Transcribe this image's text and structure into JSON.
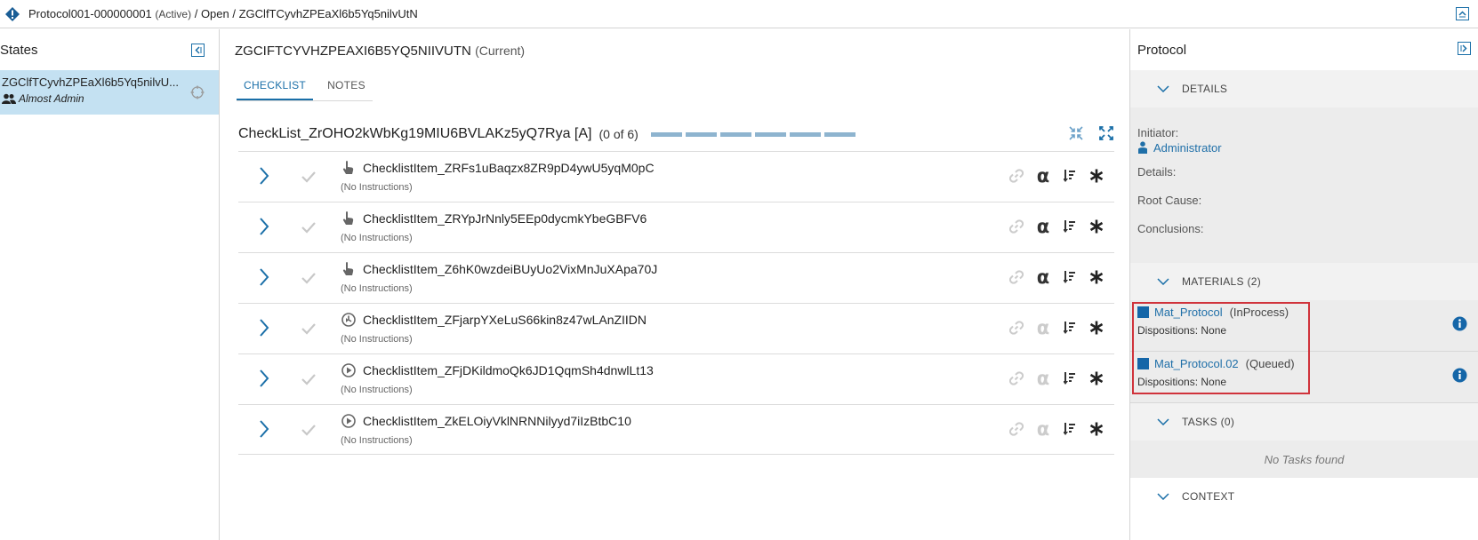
{
  "topbar": {
    "protocol_id": "Protocol001-000000001",
    "protocol_status": "(Active)",
    "sep1": " / ",
    "state": "Open",
    "sep2": " / ",
    "item": "ZGClfTCyvhZPEaXl6b5Yq5nilvUtN"
  },
  "left": {
    "title": "States",
    "items": [
      {
        "name": "ZGClfTCyvhZPEaXl6b5Yq5nilvU...",
        "user": "Almost Admin"
      }
    ]
  },
  "center": {
    "title": "ZGCIFTCYVHZPEAXI6B5YQ5NIIVUTN",
    "title_suffix": "(Current)",
    "tabs": [
      "CHECKLIST",
      "NOTES"
    ],
    "checklist": {
      "title": "CheckList_ZrOHO2kWbKg19MIU6BVLAKz5yQ7Rya [A]",
      "count": "(0 of 6)",
      "progress_total": 6,
      "progress_done": 0
    },
    "items": [
      {
        "name": "ChecklistItem_ZRFs1uBaqzx8ZR9pD4ywU5yqM0pC",
        "instructions": "(No Instructions)",
        "type": "manual-icon",
        "active_icons": true
      },
      {
        "name": "ChecklistItem_ZRYpJrNnly5EEp0dycmkYbeGBFV6",
        "instructions": "(No Instructions)",
        "type": "manual-icon",
        "active_icons": true
      },
      {
        "name": "ChecklistItem_Z6hK0wzdeiBUyUo2VixMnJuXApa70J",
        "instructions": "(No Instructions)",
        "type": "manual-icon",
        "active_icons": true
      },
      {
        "name": "ChecklistItem_ZFjarpYXeLuS66kin8z47wLAnZIIDN",
        "instructions": "(No Instructions)",
        "type": "timer-icon",
        "active_icons": false
      },
      {
        "name": "ChecklistItem_ZFjDKildmoQk6JD1QqmSh4dnwlLt13",
        "instructions": "(No Instructions)",
        "type": "play-icon",
        "active_icons": false
      },
      {
        "name": "ChecklistItem_ZkELOiyVklNRNNilyyd7iIzBtbC10",
        "instructions": "(No Instructions)",
        "type": "play-icon",
        "active_icons": false
      }
    ]
  },
  "right": {
    "title": "Protocol",
    "details": {
      "header": "DETAILS",
      "initiator_label": "Initiator:",
      "initiator_value": "Administrator",
      "details_label": "Details:",
      "root_cause_label": "Root Cause:",
      "conclusions_label": "Conclusions:"
    },
    "materials": {
      "header": "MATERIALS (2)",
      "items": [
        {
          "name": "Mat_Protocol",
          "status": "(InProcess)",
          "dispositions": "Dispositions: None"
        },
        {
          "name": "Mat_Protocol.02",
          "status": "(Queued)",
          "dispositions": "Dispositions: None"
        }
      ]
    },
    "tasks": {
      "header": "TASKS (0)",
      "empty": "No Tasks found"
    },
    "context": {
      "header": "CONTEXT"
    }
  },
  "colors": {
    "accent": "#1a6fa8",
    "selected_bg": "#c4e1f2",
    "progress": "#8eb4cf",
    "highlight": "#d0333b"
  }
}
